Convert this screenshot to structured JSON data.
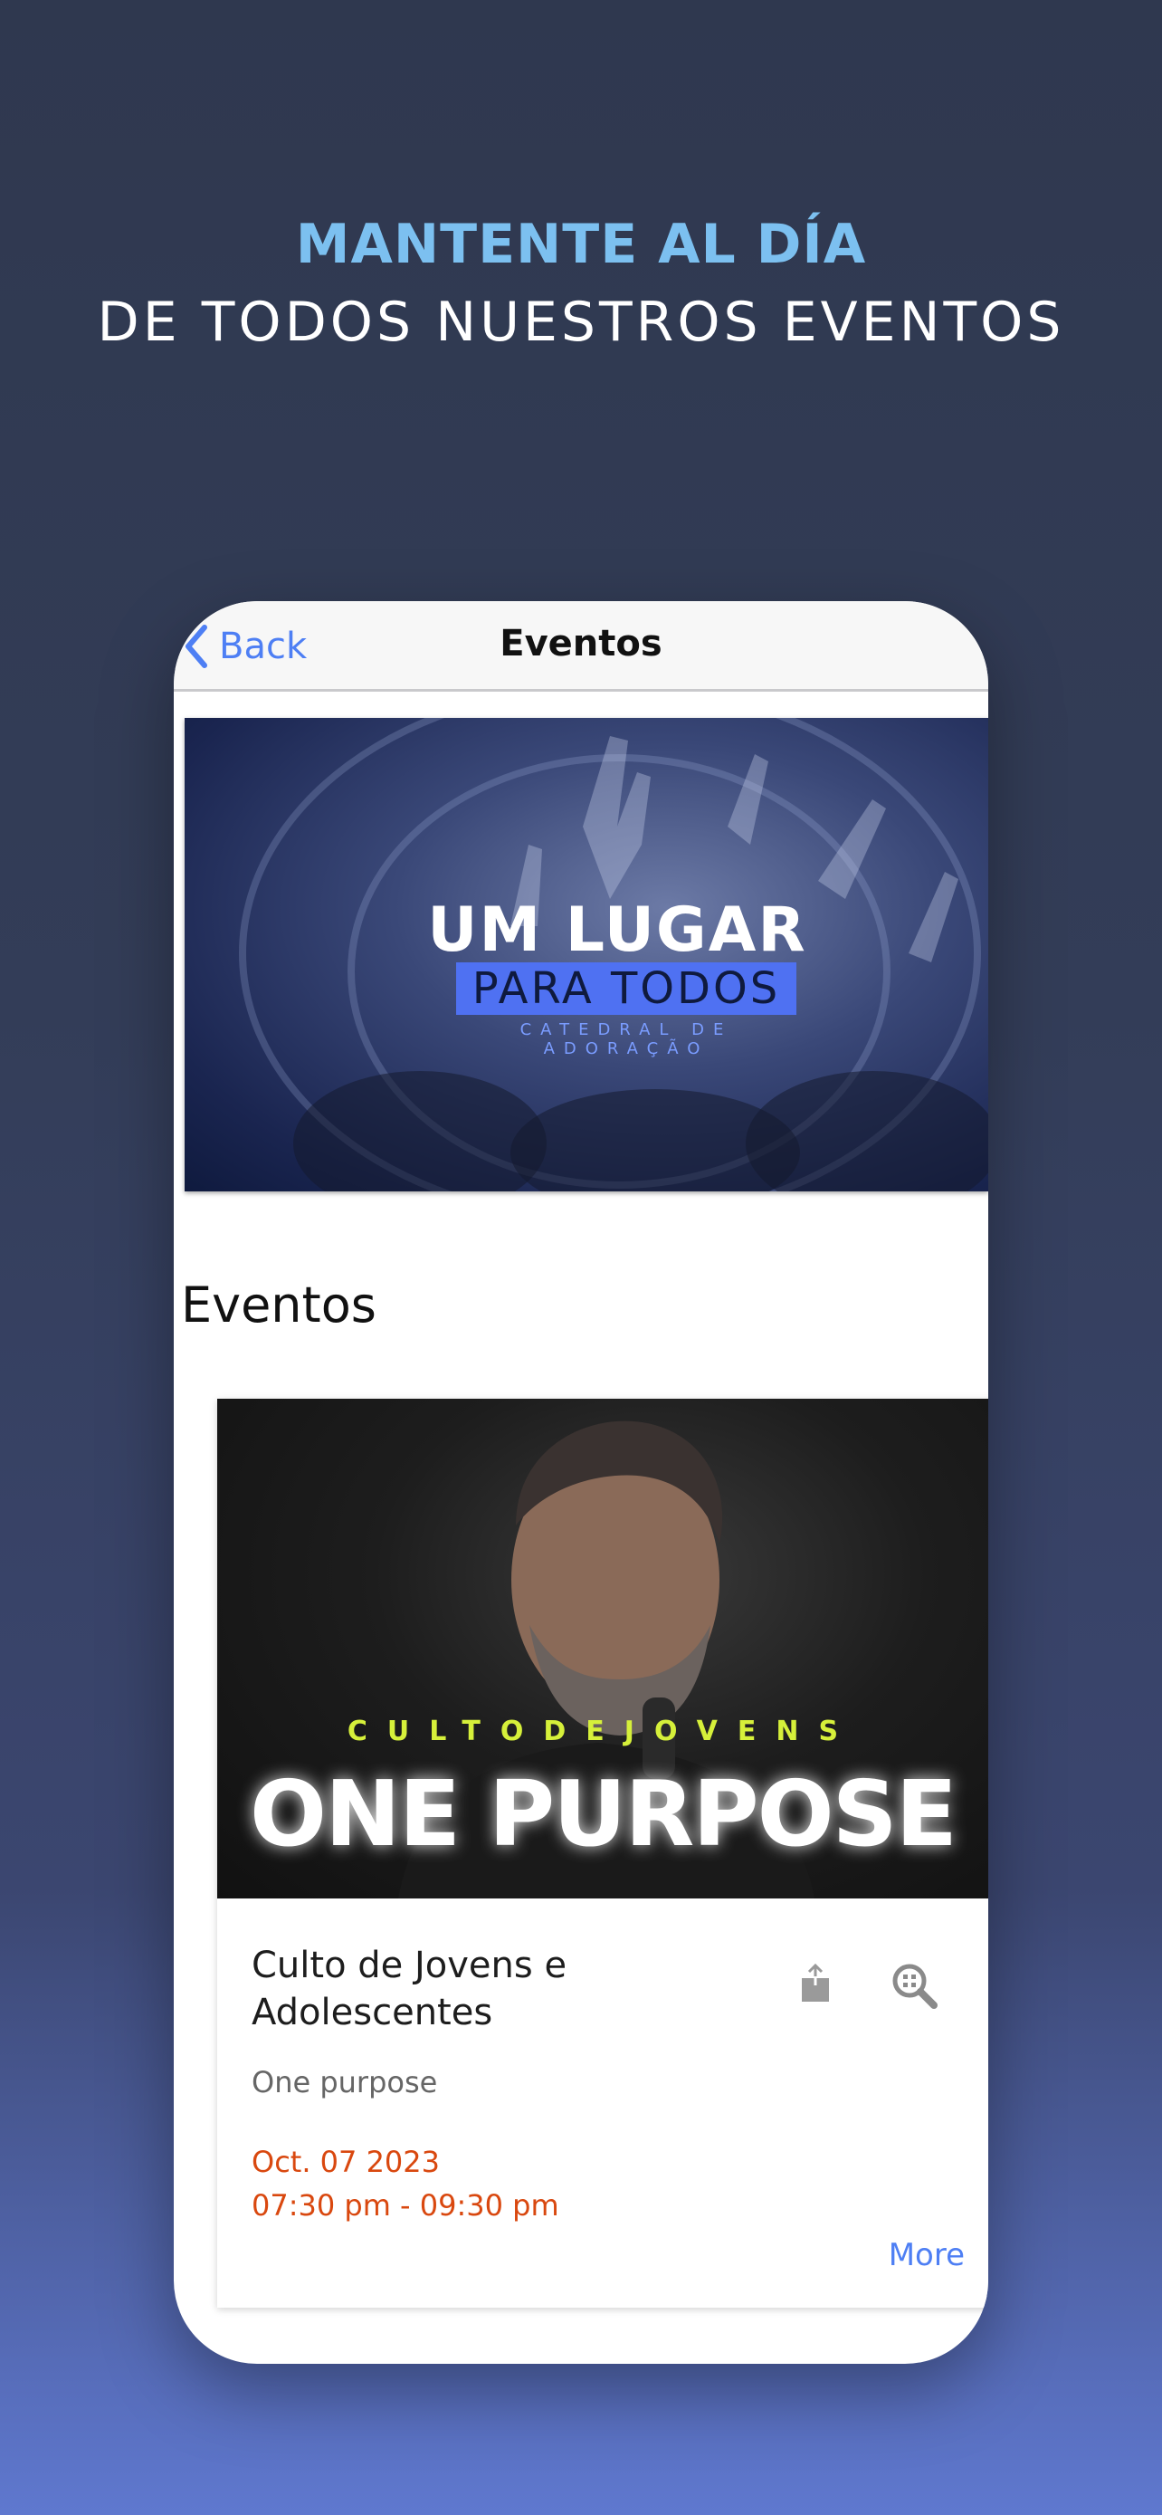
{
  "headline": {
    "line1": "MANTENTE AL DÍA",
    "line2": "DE TODOS NUESTROS EVENTOS"
  },
  "navbar": {
    "back_label": "Back",
    "title": "Eventos"
  },
  "banner": {
    "title": "UM LUGAR",
    "highlight": "PARA TODOS",
    "subtitle": "CATEDRAL DE ADORAÇÃO"
  },
  "section": {
    "title": "Eventos"
  },
  "event_card": {
    "poster_subtitle": "CULTODEJOVENS",
    "poster_title": "ONE PURPOSE",
    "title": "Culto de Jovens e Adolescentes",
    "subtitle": "One purpose",
    "date": "Oct. 07 2023",
    "time": "07:30 pm - 09:30 pm",
    "more_label": "More"
  },
  "colors": {
    "accent_blue": "#4e7ff4",
    "headline_blue": "#7cc0f0",
    "date_orange": "#d9480f"
  }
}
